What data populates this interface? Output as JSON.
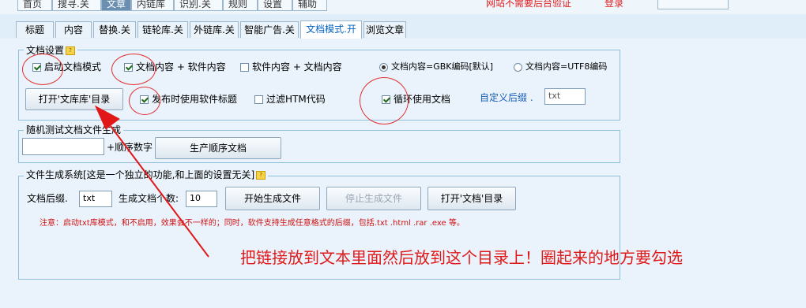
{
  "top_nav": {
    "items": [
      "首页",
      "搜寻.关",
      "文章",
      "内链库",
      "识别.关",
      "规则",
      "设置",
      "辅助"
    ],
    "active_index": 2,
    "status_red_1": "网站不需要后台验证",
    "status_red_2": "登录"
  },
  "tabs": [
    "标题",
    "内容",
    "替换.关",
    "链轮库.关",
    "外链库.关",
    "智能广告.关",
    "文档模式.开",
    "浏览文章"
  ],
  "active_tab_index": 6,
  "doc_settings": {
    "legend": "文档设置",
    "enable_doc_mode": "启动文档模式",
    "doc_plus_soft": "文档内容 + 软件内容",
    "soft_plus_doc": "软件内容 + 文档内容",
    "gbk_radio": "文档内容=GBK编码[默认]",
    "utf8_radio": "文档内容=UTF8编码",
    "open_doc_lib_btn": "打开'文库库'目录",
    "use_soft_title": "发布时使用软件标题",
    "filter_html": "过滤HTM代码",
    "loop_docs": "循环使用文档",
    "custom_suffix_label": "自定义后缀 .",
    "custom_suffix_value": "txt",
    "checks": {
      "enable_doc_mode": true,
      "doc_plus_soft": true,
      "soft_plus_doc": false,
      "use_soft_title": true,
      "filter_html": false,
      "loop_docs": true
    },
    "gbk_selected": true
  },
  "random_test": {
    "legend": "随机测试文档文件生成",
    "input_value": "",
    "suffix_label": "+顺序数字",
    "generate_btn": "生产顺序文档"
  },
  "file_gen": {
    "legend": "文件生成系统[这是一个独立的功能,和上面的设置无关]",
    "suffix_label": "文档后缀.",
    "suffix_value": "txt",
    "count_label": "生成文档个数:",
    "count_value": "10",
    "start_btn": "开始生成文件",
    "stop_btn": "停止生成文件",
    "open_dir_btn": "打开'文档'目录",
    "note": "注意：启动txt库模式，和不启用，效果会不一样的；同时，软件支持生成任意格式的后缀，包括.txt .html .rar .exe 等。"
  },
  "annotation": {
    "text": "把链接放到文本里面然后放到这个目录上！圈起来的地方要勾选",
    "color": "#e01818"
  }
}
